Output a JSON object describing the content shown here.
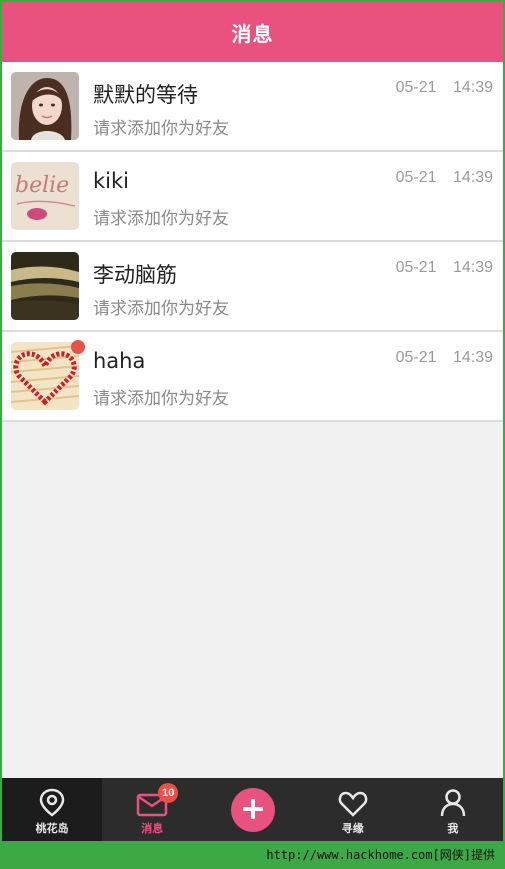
{
  "header": {
    "title": "消息"
  },
  "messages": [
    {
      "name": "默默的等待",
      "text": "请求添加你为好友",
      "time": "05-21 14:39",
      "avatar": "girl-portrait-photo",
      "unread": false
    },
    {
      "name": "kiki",
      "text": "请求添加你为好友",
      "time": "05-21 14:39",
      "avatar": "believe-writing-photo",
      "unread": false
    },
    {
      "name": "李动脑筋",
      "text": "请求添加你为好友",
      "time": "05-21 14:39",
      "avatar": "landscape-photo",
      "unread": false
    },
    {
      "name": "haha",
      "text": "请求添加你为好友",
      "time": "05-21 14:39",
      "avatar": "matchstick-heart-photo",
      "unread": true
    }
  ],
  "tabbar": {
    "tabs": [
      {
        "label": "桃花岛",
        "icon": "location-pin-icon"
      },
      {
        "label": "消息",
        "icon": "mail-icon",
        "badge": "10",
        "active": true
      },
      {
        "label": "",
        "icon": "plus-icon"
      },
      {
        "label": "寻缘",
        "icon": "heart-icon"
      },
      {
        "label": "我",
        "icon": "person-icon"
      }
    ]
  },
  "watermark": "http://www.hackhome.com[网侠]提供",
  "colors": {
    "accent": "#e9517f",
    "badge": "#e8504a",
    "tabbar": "#2c2c2c"
  }
}
